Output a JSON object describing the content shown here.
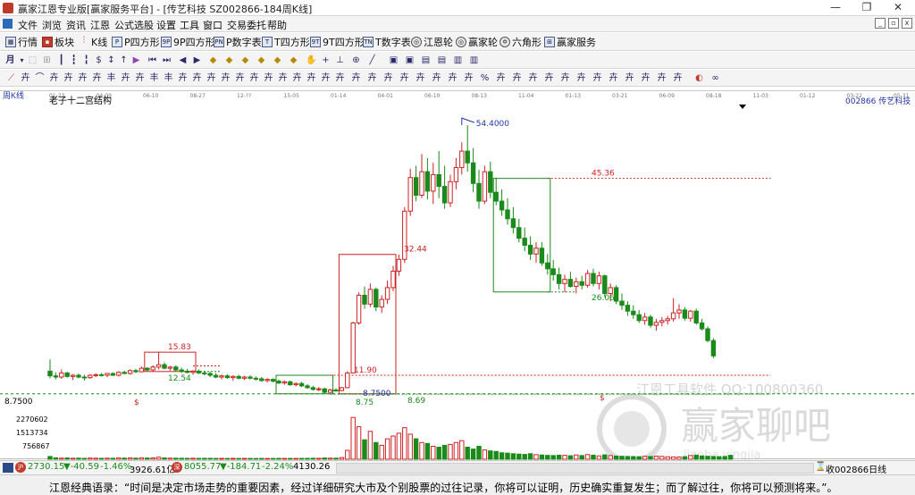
{
  "window": {
    "title": "赢家江恩专业版[赢家服务平台] - [传艺科技  SZ002866-184周K线]",
    "min_glyph": "—",
    "max_glyph": "❐",
    "close_glyph": "✕"
  },
  "menu": {
    "items": [
      "文件",
      "浏览",
      "资讯",
      "江恩",
      "公式选股",
      "设置",
      "工具",
      "窗口",
      "交易委托",
      "帮助"
    ],
    "mdi_controls": [
      "_",
      "▫",
      "x"
    ]
  },
  "toolbar1": {
    "items": [
      {
        "label": "行情",
        "icon": "grid-icon"
      },
      {
        "label": "板块",
        "icon": "blocks-icon"
      },
      {
        "label": "K线",
        "icon": "candles-icon"
      },
      {
        "label": "P四方形",
        "icon": "p-square-icon",
        "tag": "P"
      },
      {
        "label": "9P四方形",
        "icon": "9p-square-icon",
        "tag": "9P"
      },
      {
        "label": "P数字表",
        "icon": "p-number-icon",
        "tag": "PN"
      },
      {
        "label": "T四方形",
        "icon": "t-square-icon",
        "tag": "T"
      },
      {
        "label": "9T四方形",
        "icon": "9t-square-icon",
        "tag": "9T"
      },
      {
        "label": "T数字表",
        "icon": "t-number-icon",
        "tag": "TN"
      },
      {
        "label": "江恩轮",
        "icon": "gann-wheel-icon",
        "tag": "◎"
      },
      {
        "label": "赢家轮",
        "icon": "winner-wheel-icon",
        "tag": "◎"
      },
      {
        "label": "六角形",
        "icon": "hexagon-icon",
        "tag": "✡"
      },
      {
        "label": "赢家服务",
        "icon": "service-icon",
        "tag": "⊞"
      }
    ]
  },
  "chart_panel": {
    "period_label": "周K线",
    "indicator_title": "老子十二宫结构",
    "stock_label": "002866  传艺科技",
    "watermark_vendor": "江恩工具软件  QQ:100800360",
    "watermark_forum": "赢家聊吧",
    "watermark_url": "jiaoba.yingjia",
    "date_ticks": [
      "01-23",
      "04-09",
      "06-10",
      "08-27",
      "12-??",
      "15-05",
      "01-14",
      "04-01",
      "06-10",
      "08-13",
      "11-04",
      "01-13",
      "03-21",
      "06-09",
      "08-18",
      "11-03",
      "01-12",
      "03-22",
      "05-31",
      "08-08"
    ]
  },
  "chart_data": {
    "type": "candlestick",
    "title": "老子十二宫结构",
    "price_labels": [
      "54.4000",
      "45.36",
      "32.44",
      "26.06",
      "15.83",
      "12.54",
      "11.90",
      "8.7500",
      "8.75",
      "8.69"
    ],
    "price_axis_label": "8.7500",
    "volume_axis_labels": [
      "2270602",
      "1513734",
      "756867"
    ],
    "price_range": [
      7.5,
      57
    ],
    "volume_range": [
      0,
      2500000
    ],
    "candles": [
      {
        "o": 12.6,
        "h": 14.6,
        "l": 11.4,
        "c": 11.8
      },
      {
        "o": 11.8,
        "h": 12.4,
        "l": 11.2,
        "c": 11.6
      },
      {
        "o": 11.6,
        "h": 12.9,
        "l": 11.3,
        "c": 12.3
      },
      {
        "o": 12.3,
        "h": 12.5,
        "l": 11.5,
        "c": 11.7
      },
      {
        "o": 11.7,
        "h": 12.1,
        "l": 11.1,
        "c": 11.9
      },
      {
        "o": 11.9,
        "h": 12.2,
        "l": 11.4,
        "c": 11.6
      },
      {
        "o": 11.6,
        "h": 12.0,
        "l": 11.0,
        "c": 11.5
      },
      {
        "o": 11.5,
        "h": 12.1,
        "l": 11.3,
        "c": 11.9
      },
      {
        "o": 11.9,
        "h": 12.2,
        "l": 11.6,
        "c": 12.0
      },
      {
        "o": 12.0,
        "h": 12.3,
        "l": 11.7,
        "c": 11.9
      },
      {
        "o": 11.9,
        "h": 12.3,
        "l": 11.6,
        "c": 12.2
      },
      {
        "o": 12.2,
        "h": 12.4,
        "l": 11.8,
        "c": 11.9
      },
      {
        "o": 11.9,
        "h": 12.6,
        "l": 11.7,
        "c": 12.4
      },
      {
        "o": 12.4,
        "h": 12.7,
        "l": 12.1,
        "c": 12.2
      },
      {
        "o": 12.2,
        "h": 12.9,
        "l": 12.0,
        "c": 12.7
      },
      {
        "o": 12.7,
        "h": 13.0,
        "l": 12.3,
        "c": 12.5
      },
      {
        "o": 12.5,
        "h": 13.4,
        "l": 12.4,
        "c": 13.1
      },
      {
        "o": 13.1,
        "h": 13.3,
        "l": 12.6,
        "c": 12.8
      },
      {
        "o": 12.8,
        "h": 13.6,
        "l": 12.6,
        "c": 13.3
      },
      {
        "o": 13.3,
        "h": 15.8,
        "l": 12.9,
        "c": 13.7
      },
      {
        "o": 13.7,
        "h": 14.1,
        "l": 12.9,
        "c": 13.1
      },
      {
        "o": 13.1,
        "h": 13.5,
        "l": 12.7,
        "c": 13.3
      },
      {
        "o": 13.3,
        "h": 13.6,
        "l": 12.5,
        "c": 12.8
      },
      {
        "o": 12.8,
        "h": 13.2,
        "l": 12.3,
        "c": 12.6
      },
      {
        "o": 12.6,
        "h": 13.0,
        "l": 12.2,
        "c": 12.4
      },
      {
        "o": 12.4,
        "h": 12.8,
        "l": 12.0,
        "c": 12.6
      },
      {
        "o": 12.6,
        "h": 12.9,
        "l": 12.1,
        "c": 12.3
      },
      {
        "o": 12.3,
        "h": 12.7,
        "l": 11.9,
        "c": 12.2
      },
      {
        "o": 12.2,
        "h": 12.5,
        "l": 11.6,
        "c": 11.9
      },
      {
        "o": 11.9,
        "h": 12.3,
        "l": 11.4,
        "c": 11.6
      },
      {
        "o": 11.6,
        "h": 12.0,
        "l": 11.2,
        "c": 11.8
      },
      {
        "o": 11.8,
        "h": 12.1,
        "l": 11.3,
        "c": 11.5
      },
      {
        "o": 11.5,
        "h": 11.9,
        "l": 11.0,
        "c": 11.7
      },
      {
        "o": 11.7,
        "h": 12.0,
        "l": 11.2,
        "c": 11.4
      },
      {
        "o": 11.4,
        "h": 11.8,
        "l": 11.1,
        "c": 11.6
      },
      {
        "o": 11.6,
        "h": 11.9,
        "l": 11.2,
        "c": 11.4
      },
      {
        "o": 11.4,
        "h": 11.7,
        "l": 11.0,
        "c": 11.3
      },
      {
        "o": 11.3,
        "h": 11.6,
        "l": 10.8,
        "c": 11.0
      },
      {
        "o": 11.0,
        "h": 11.4,
        "l": 10.7,
        "c": 11.2
      },
      {
        "o": 11.2,
        "h": 11.4,
        "l": 10.7,
        "c": 10.9
      },
      {
        "o": 10.9,
        "h": 11.2,
        "l": 10.4,
        "c": 10.6
      },
      {
        "o": 10.6,
        "h": 11.0,
        "l": 10.3,
        "c": 10.8
      },
      {
        "o": 10.8,
        "h": 11.0,
        "l": 10.1,
        "c": 10.3
      },
      {
        "o": 10.3,
        "h": 10.7,
        "l": 10.0,
        "c": 10.5
      },
      {
        "o": 10.5,
        "h": 10.8,
        "l": 9.9,
        "c": 10.1
      },
      {
        "o": 10.1,
        "h": 10.4,
        "l": 9.6,
        "c": 9.8
      },
      {
        "o": 9.8,
        "h": 10.1,
        "l": 9.3,
        "c": 9.5
      },
      {
        "o": 9.5,
        "h": 9.9,
        "l": 9.2,
        "c": 9.6
      },
      {
        "o": 9.6,
        "h": 9.8,
        "l": 8.75,
        "c": 9.0
      },
      {
        "o": 9.0,
        "h": 9.6,
        "l": 8.9,
        "c": 9.4
      },
      {
        "o": 9.4,
        "h": 9.7,
        "l": 9.1,
        "c": 9.3
      },
      {
        "o": 9.3,
        "h": 9.9,
        "l": 9.2,
        "c": 9.8
      },
      {
        "o": 9.8,
        "h": 12.6,
        "l": 9.7,
        "c": 12.3
      },
      {
        "o": 12.3,
        "h": 21.0,
        "l": 12.2,
        "c": 20.8
      },
      {
        "o": 20.8,
        "h": 26.0,
        "l": 20.5,
        "c": 25.5
      },
      {
        "o": 25.5,
        "h": 27.0,
        "l": 23.2,
        "c": 24.0
      },
      {
        "o": 24.0,
        "h": 27.5,
        "l": 23.5,
        "c": 26.5
      },
      {
        "o": 26.5,
        "h": 26.8,
        "l": 22.8,
        "c": 23.5
      },
      {
        "o": 23.5,
        "h": 25.5,
        "l": 22.5,
        "c": 24.8
      },
      {
        "o": 24.8,
        "h": 28.0,
        "l": 24.0,
        "c": 26.8
      },
      {
        "o": 26.8,
        "h": 30.5,
        "l": 26.2,
        "c": 29.6
      },
      {
        "o": 29.6,
        "h": 32.4,
        "l": 28.8,
        "c": 31.6
      },
      {
        "o": 31.6,
        "h": 40.5,
        "l": 31.0,
        "c": 39.8
      },
      {
        "o": 39.8,
        "h": 47.0,
        "l": 39.0,
        "c": 45.5
      },
      {
        "o": 45.5,
        "h": 47.5,
        "l": 41.5,
        "c": 42.5
      },
      {
        "o": 42.5,
        "h": 49.5,
        "l": 42.0,
        "c": 46.5
      },
      {
        "o": 46.5,
        "h": 48.8,
        "l": 41.8,
        "c": 43.2
      },
      {
        "o": 43.2,
        "h": 48.0,
        "l": 41.0,
        "c": 46.0
      },
      {
        "o": 46.0,
        "h": 50.0,
        "l": 42.0,
        "c": 44.0
      },
      {
        "o": 44.0,
        "h": 47.5,
        "l": 40.2,
        "c": 41.2
      },
      {
        "o": 41.2,
        "h": 46.0,
        "l": 40.5,
        "c": 44.8
      },
      {
        "o": 44.8,
        "h": 48.8,
        "l": 43.5,
        "c": 47.2
      },
      {
        "o": 47.2,
        "h": 51.5,
        "l": 46.0,
        "c": 50.0
      },
      {
        "o": 50.0,
        "h": 54.4,
        "l": 46.5,
        "c": 48.0
      },
      {
        "o": 48.0,
        "h": 50.5,
        "l": 43.0,
        "c": 44.5
      },
      {
        "o": 44.5,
        "h": 46.8,
        "l": 40.2,
        "c": 41.5
      },
      {
        "o": 41.5,
        "h": 47.5,
        "l": 41.0,
        "c": 46.5
      },
      {
        "o": 46.5,
        "h": 48.2,
        "l": 42.0,
        "c": 43.0
      },
      {
        "o": 43.0,
        "h": 45.5,
        "l": 40.8,
        "c": 41.5
      },
      {
        "o": 41.5,
        "h": 43.5,
        "l": 39.0,
        "c": 40.0
      },
      {
        "o": 40.0,
        "h": 42.0,
        "l": 37.5,
        "c": 38.5
      },
      {
        "o": 38.5,
        "h": 40.5,
        "l": 36.0,
        "c": 37.0
      },
      {
        "o": 37.0,
        "h": 38.5,
        "l": 34.5,
        "c": 35.2
      },
      {
        "o": 35.2,
        "h": 37.0,
        "l": 33.0,
        "c": 34.0
      },
      {
        "o": 34.0,
        "h": 35.5,
        "l": 31.5,
        "c": 32.5
      },
      {
        "o": 32.5,
        "h": 34.5,
        "l": 31.0,
        "c": 33.5
      },
      {
        "o": 33.5,
        "h": 34.5,
        "l": 30.5,
        "c": 31.0
      },
      {
        "o": 31.0,
        "h": 32.5,
        "l": 29.0,
        "c": 30.0
      },
      {
        "o": 30.0,
        "h": 31.5,
        "l": 28.0,
        "c": 29.0
      },
      {
        "o": 29.0,
        "h": 30.2,
        "l": 26.5,
        "c": 27.5
      },
      {
        "o": 27.5,
        "h": 29.0,
        "l": 26.0,
        "c": 28.2
      },
      {
        "o": 28.2,
        "h": 29.5,
        "l": 26.8,
        "c": 27.0
      },
      {
        "o": 27.0,
        "h": 28.5,
        "l": 25.8,
        "c": 27.8
      },
      {
        "o": 27.8,
        "h": 28.8,
        "l": 26.5,
        "c": 27.2
      },
      {
        "o": 27.2,
        "h": 29.8,
        "l": 26.8,
        "c": 29.2
      },
      {
        "o": 29.2,
        "h": 30.0,
        "l": 27.0,
        "c": 27.5
      },
      {
        "o": 27.5,
        "h": 29.5,
        "l": 26.5,
        "c": 28.8
      },
      {
        "o": 28.8,
        "h": 29.0,
        "l": 25.2,
        "c": 25.8
      },
      {
        "o": 25.8,
        "h": 27.5,
        "l": 24.5,
        "c": 26.8
      },
      {
        "o": 26.8,
        "h": 27.2,
        "l": 24.0,
        "c": 24.5
      },
      {
        "o": 24.5,
        "h": 25.8,
        "l": 23.0,
        "c": 23.8
      },
      {
        "o": 23.8,
        "h": 24.5,
        "l": 22.0,
        "c": 22.8
      },
      {
        "o": 22.8,
        "h": 23.8,
        "l": 21.5,
        "c": 22.2
      },
      {
        "o": 22.2,
        "h": 23.0,
        "l": 20.8,
        "c": 21.2
      },
      {
        "o": 21.2,
        "h": 22.5,
        "l": 20.5,
        "c": 21.8
      },
      {
        "o": 21.8,
        "h": 22.2,
        "l": 20.0,
        "c": 20.4
      },
      {
        "o": 20.4,
        "h": 21.5,
        "l": 19.5,
        "c": 20.9
      },
      {
        "o": 20.9,
        "h": 21.8,
        "l": 20.2,
        "c": 21.2
      },
      {
        "o": 21.2,
        "h": 22.0,
        "l": 20.5,
        "c": 21.5
      },
      {
        "o": 21.5,
        "h": 25.0,
        "l": 21.0,
        "c": 22.5
      },
      {
        "o": 22.5,
        "h": 24.0,
        "l": 21.5,
        "c": 23.0
      },
      {
        "o": 23.0,
        "h": 23.5,
        "l": 21.2,
        "c": 21.6
      },
      {
        "o": 21.6,
        "h": 23.0,
        "l": 21.0,
        "c": 22.8
      },
      {
        "o": 22.8,
        "h": 23.2,
        "l": 20.5,
        "c": 20.8
      },
      {
        "o": 20.8,
        "h": 21.5,
        "l": 19.5,
        "c": 19.8
      },
      {
        "o": 19.8,
        "h": 20.2,
        "l": 17.5,
        "c": 17.8
      },
      {
        "o": 17.8,
        "h": 18.2,
        "l": 14.8,
        "c": 15.2
      }
    ],
    "volumes": [
      150000,
      80000,
      60000,
      70000,
      55000,
      60000,
      50000,
      65000,
      58000,
      52000,
      60000,
      55000,
      70000,
      62000,
      75000,
      60000,
      80000,
      66000,
      72000,
      110000,
      70000,
      60000,
      58000,
      52000,
      50000,
      55000,
      48000,
      52000,
      50000,
      46000,
      48000,
      45000,
      50000,
      44000,
      47000,
      45000,
      43000,
      46000,
      42000,
      45000,
      48000,
      44000,
      46000,
      43000,
      47000,
      50000,
      55000,
      52000,
      70000,
      60000,
      58000,
      90000,
      480000,
      2250000,
      1750000,
      1050000,
      1500000,
      900000,
      750000,
      1100000,
      1250000,
      1400000,
      1700000,
      1350000,
      1100000,
      900000,
      850000,
      700000,
      650000,
      750000,
      800000,
      900000,
      1000000,
      650000,
      550000,
      700000,
      500000,
      450000,
      420000,
      350000,
      330000,
      300000,
      280000,
      260000,
      300000,
      250000,
      230000,
      210000,
      200000,
      220000,
      210000,
      190000,
      230000,
      200000,
      250000,
      220000,
      180000,
      240000,
      200000,
      170000,
      160000,
      150000,
      145000,
      140000,
      160000,
      150000,
      170000,
      155000,
      130000,
      125000,
      120000,
      140000,
      200000,
      220000,
      180000,
      160000,
      150000,
      140000,
      150000,
      210000
    ],
    "boxes": [
      {
        "color": "#cc2222",
        "i0": 17,
        "i1": 25,
        "top": 15.83,
        "bottom": 12.54
      },
      {
        "color": "#1a8a1a",
        "i0": 40,
        "i1": 49,
        "top": 11.9,
        "bottom": 8.75
      },
      {
        "color": "#cc2222",
        "i0": 51,
        "i1": 60,
        "top": 32.44,
        "bottom": 8.75
      },
      {
        "color": "#1a8a1a",
        "i0": 78,
        "i1": 87,
        "top": 45.36,
        "bottom": 26.06
      }
    ],
    "hlines": [
      {
        "price": 45.36,
        "color": "#cc2222",
        "i0": 87,
        "i1": 126
      },
      {
        "price": 11.9,
        "color": "#cc2222",
        "i0": 49,
        "i1": 126
      },
      {
        "price": 8.69,
        "color": "#1a8a1a",
        "i0": 49,
        "i1": 126
      },
      {
        "price": 12.54,
        "color": "#1a8a1a",
        "i0": 25,
        "i1": 30
      },
      {
        "price": 26.06,
        "color": "#1a8a1a",
        "i0": 87,
        "i1": 92
      },
      {
        "price": 13.5,
        "color": "#cc2222",
        "i0": 25,
        "i1": 30
      }
    ]
  },
  "statusbar": {
    "sh_value": "2730.15",
    "sh_change": "▼-40.59",
    "sh_pct": "-1.46%",
    "sh_amount": "3926.61亿",
    "sz_value": "8055.77",
    "sz_change": "▼-184.71",
    "sz_pct": "-2.24%",
    "sz_amount": "4130.26",
    "right_text": "收002866日线",
    "up_color": "#c0392b",
    "down_color": "#1a8a1a"
  },
  "quote": {
    "text": "江恩经典语录：“时间是决定市场走势的重要因素，经过详细研究大市及个别股票的过往记录，你将可以证明，历史确实重复发生；而了解过往，你将可以预测将来。”。"
  },
  "colors": {
    "up": "#cc2222",
    "down": "#1a8a1a",
    "label_blue": "#2233aa"
  }
}
